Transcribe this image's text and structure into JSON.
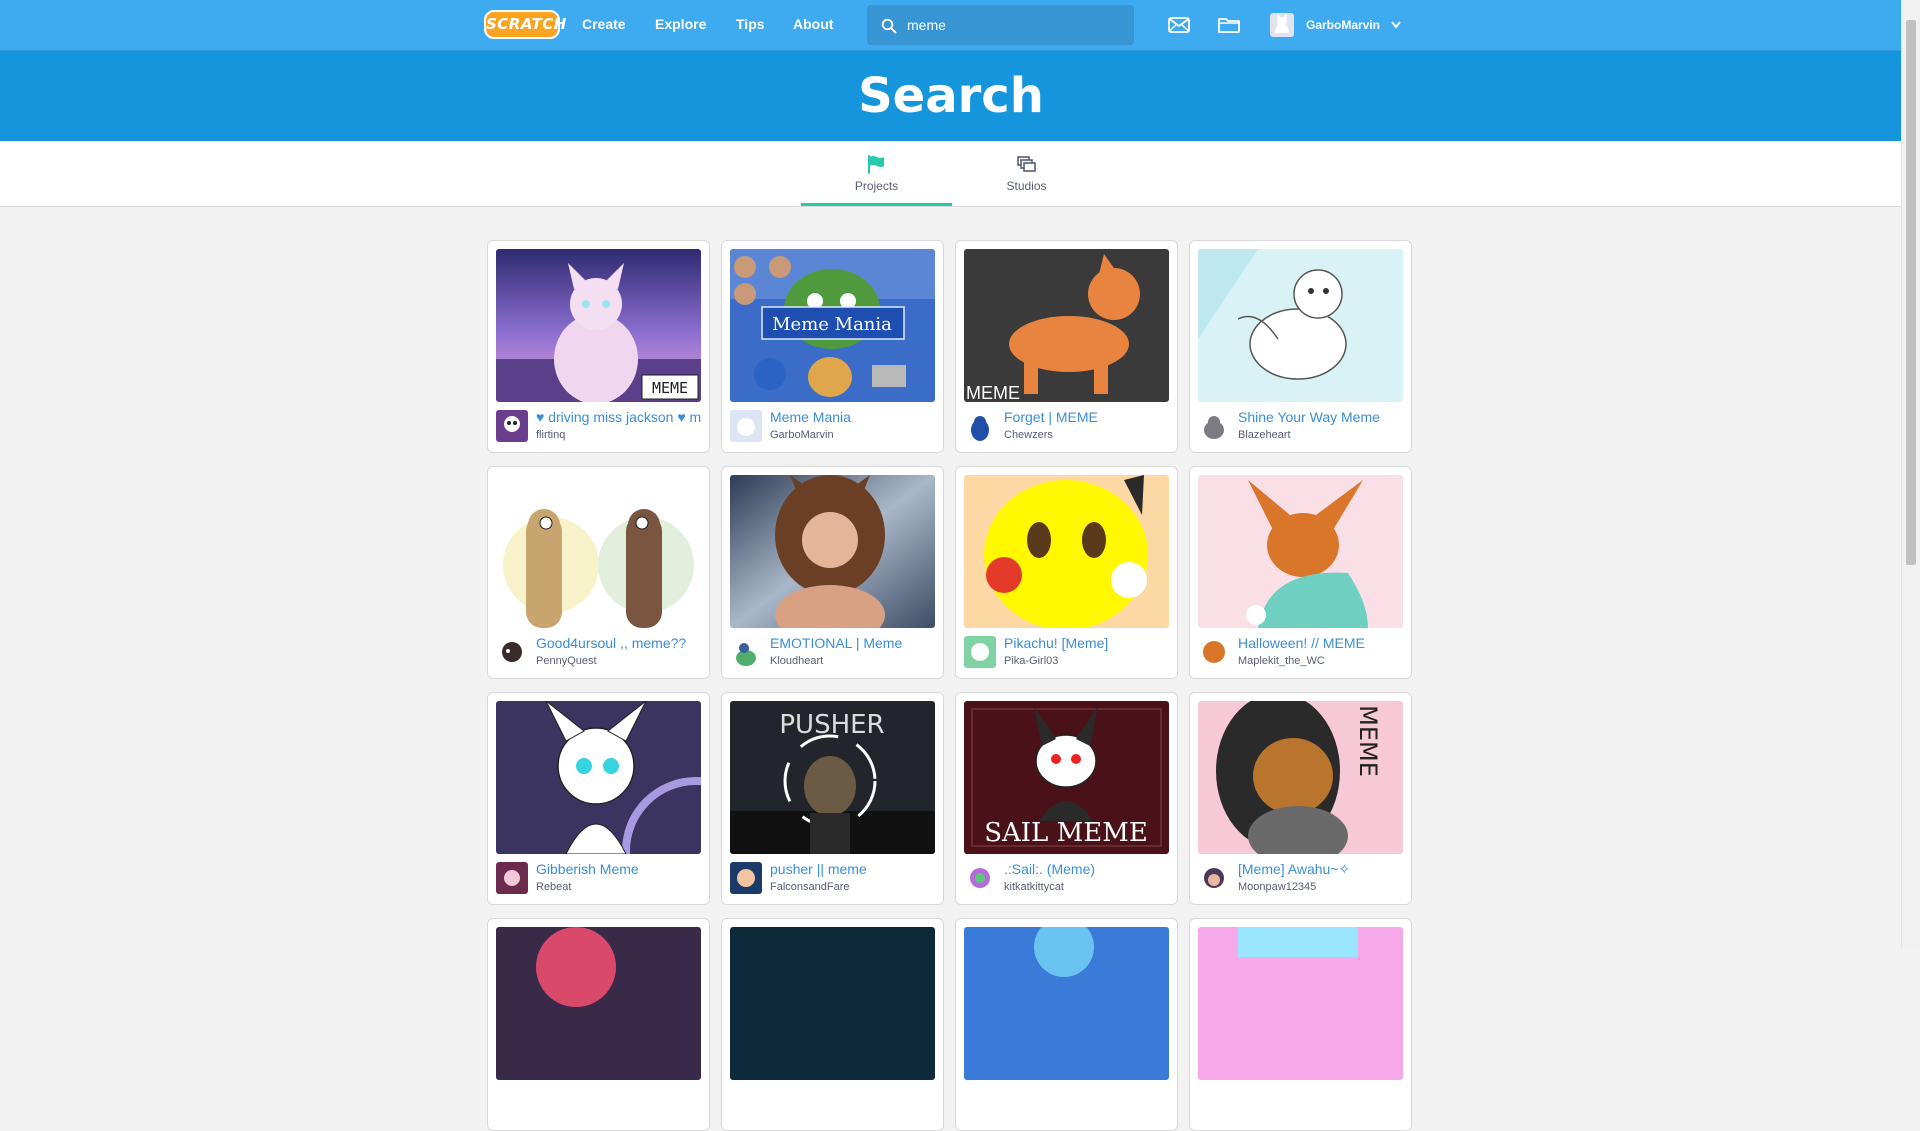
{
  "nav": {
    "logo": "SCRATCH",
    "links": [
      "Create",
      "Explore",
      "Tips",
      "About"
    ],
    "search_value": "meme",
    "username": "GarboMarvin"
  },
  "banner": {
    "title": "Search"
  },
  "tabs": [
    {
      "label": "Projects",
      "icon": "flag-icon",
      "active": true
    },
    {
      "label": "Studios",
      "icon": "studios-icon",
      "active": false
    }
  ],
  "projects": [
    {
      "title": "♥ driving miss jackson ♥ m",
      "author": "flirtinq",
      "thumb_text": "MEME"
    },
    {
      "title": "Meme Mania",
      "author": "GarboMarvin",
      "thumb_text": "Meme Mania"
    },
    {
      "title": "Forget | MEME",
      "author": "Chewzers",
      "thumb_text": "MEME"
    },
    {
      "title": "Shine Your Way Meme",
      "author": "Blazeheart",
      "thumb_text": ""
    },
    {
      "title": "Good4ursoul ,, meme??",
      "author": "PennyQuest",
      "thumb_text": ""
    },
    {
      "title": "EMOTIONAL | Meme",
      "author": "Kloudheart",
      "thumb_text": ""
    },
    {
      "title": "Pikachu! [Meme]",
      "author": "Pika-Girl03",
      "thumb_text": ""
    },
    {
      "title": "Halloween! // MEME",
      "author": "Maplekit_the_WC",
      "thumb_text": ""
    },
    {
      "title": "Gibberish Meme",
      "author": "Rebeat",
      "thumb_text": ""
    },
    {
      "title": "pusher || meme",
      "author": "FalconsandFare",
      "thumb_text": "PUSHER"
    },
    {
      "title": ".:Sail:. (Meme)",
      "author": "kitkatkittycat",
      "thumb_text": "SAIL MEME"
    },
    {
      "title": "[Meme] Awahu~✧",
      "author": "Moonpaw12345",
      "thumb_text": "MEME"
    }
  ]
}
